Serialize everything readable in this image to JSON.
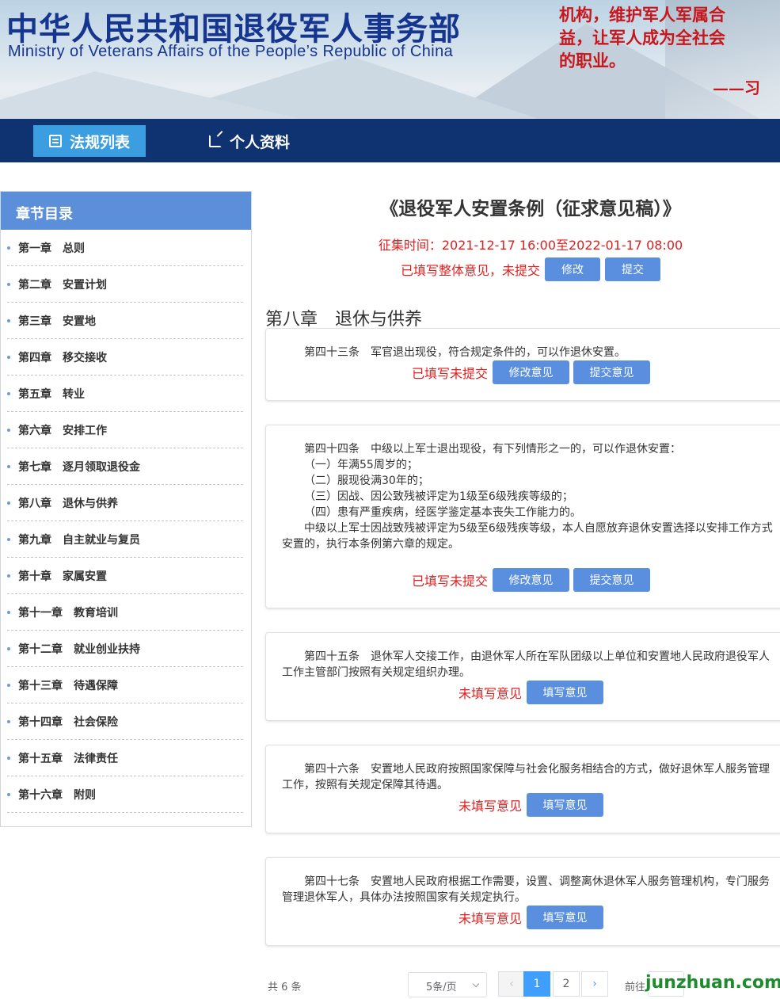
{
  "header": {
    "title_cn": "中华人民共和国退役军人事务部",
    "title_en": "Ministry of Veterans Affairs of the People’s Republic of China",
    "quote_lines": [
      "机构，维护军人军属合",
      "益，让军人成为全社会",
      "的职业。"
    ],
    "quote_sign": "——习"
  },
  "nav": {
    "items": [
      {
        "label": "法规列表",
        "icon": "list-icon",
        "active": true
      },
      {
        "label": "个人资料",
        "icon": "edit-icon",
        "active": false
      }
    ]
  },
  "sidebar": {
    "title": "章节目录",
    "chapters": [
      "第一章　总则",
      "第二章　安置计划",
      "第三章　安置地",
      "第四章　移交接收",
      "第五章　转业",
      "第六章　安排工作",
      "第七章　逐月领取退役金",
      "第八章　退休与供养",
      "第九章　自主就业与复员",
      "第十章　家属安置",
      "第十一章　教育培训",
      "第十二章　就业创业扶持",
      "第十三章　待遇保障",
      "第十四章　社会保险",
      "第十五章　法律责任",
      "第十六章　附则"
    ]
  },
  "main": {
    "doc_title": "《退役军人安置条例（征求意见稿）》",
    "deadline": "征集时间：2021-12-17 16:00至2022-01-17 08:00",
    "overall_status": "已填写整体意见，未提交",
    "overall_edit": "修改",
    "overall_submit": "提交",
    "chapter_title": "第八章　退休与供养",
    "articles": [
      {
        "lines": [
          "第四十三条　军官退出现役，符合规定条件的，可以作退休安置。"
        ],
        "status": "已填写未提交",
        "buttons": [
          "修改意见",
          "提交意见"
        ]
      },
      {
        "lines": [
          "第四十四条　中级以上军士退出现役，有下列情形之一的，可以作退休安置：",
          "（一）年满55周岁的；",
          "（二）服现役满30年的；",
          "（三）因战、因公致残被评定为1级至6级残疾等级的；",
          "（四）患有严重疾病，经医学鉴定基本丧失工作能力的。",
          "中级以上军士因战致残被评定为5级至6级残疾等级，本人自愿放弃退休安置选择以安排工作方式安置的，执行本条例第六章的规定。"
        ],
        "status": "已填写未提交",
        "buttons": [
          "修改意见",
          "提交意见"
        ]
      },
      {
        "lines": [
          "第四十五条　退休军人交接工作，由退休军人所在军队团级以上单位和安置地人民政府退役军人工作主管部门按照有关规定组织办理。"
        ],
        "status": "未填写意见",
        "buttons": [
          "填写意见"
        ]
      },
      {
        "lines": [
          "第四十六条　安置地人民政府按照国家保障与社会化服务相结合的方式，做好退休军人服务管理工作，按照有关规定保障其待遇。"
        ],
        "status": "未填写意见",
        "buttons": [
          "填写意见"
        ]
      },
      {
        "lines": [
          "第四十七条　安置地人民政府根据工作需要，设置、调整离休退休军人服务管理机构，专门服务管理退休军人，具体办法按照国家有关规定执行。"
        ],
        "status": "未填写意见",
        "buttons": [
          "填写意见"
        ]
      }
    ]
  },
  "pagination": {
    "total": "共 6 条",
    "page_size": "5条/页",
    "pages": [
      "1",
      "2"
    ],
    "current_page": 1,
    "prev": "‹",
    "next": "›",
    "goto_label": "前往"
  },
  "watermark": "junzhuan.com",
  "colors": {
    "nav_bg": "#0f3270",
    "nav_active": "#3b9ee0",
    "sidebar_head": "#5b8fd9",
    "button": "#5a8fe0",
    "status_red": "#e02020",
    "page_active": "#409eff"
  }
}
